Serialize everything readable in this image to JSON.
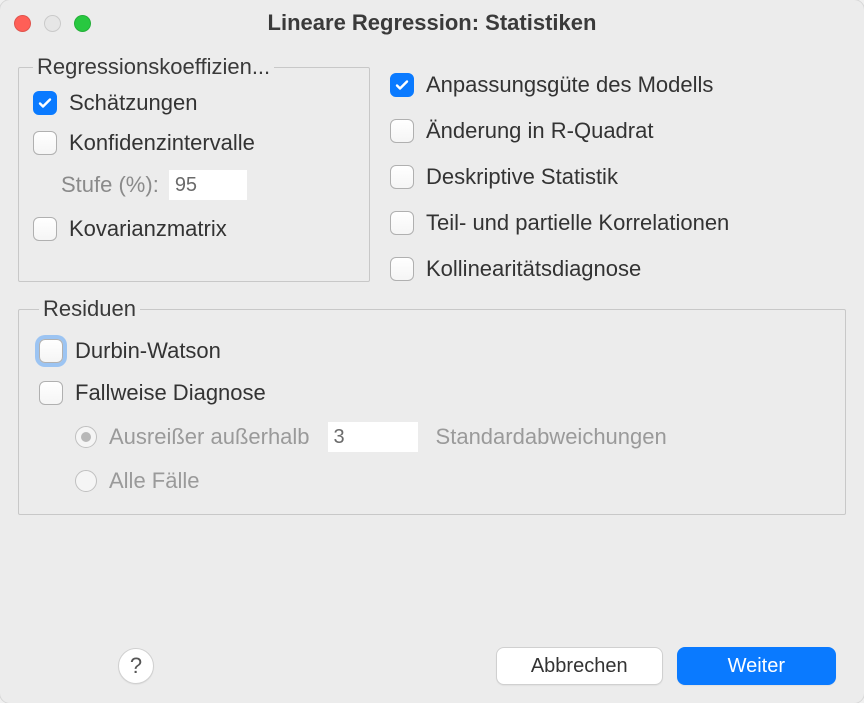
{
  "window": {
    "title": "Lineare Regression: Statistiken"
  },
  "regcoef": {
    "legend": "Regressionskoeffizien...",
    "estimates": {
      "label": "Schätzungen",
      "checked": true
    },
    "confint": {
      "label": "Konfidenzintervalle",
      "checked": false
    },
    "level": {
      "label": "Stufe (%):",
      "value": "95"
    },
    "covmatrix": {
      "label": "Kovarianzmatrix",
      "checked": false
    }
  },
  "right": {
    "modelfit": {
      "label": "Anpassungsgüte des Modells",
      "checked": true
    },
    "rsquared_change": {
      "label": "Änderung in R-Quadrat",
      "checked": false
    },
    "descriptives": {
      "label": "Deskriptive Statistik",
      "checked": false
    },
    "partial": {
      "label": "Teil- und partielle Korrelationen",
      "checked": false
    },
    "collinearity": {
      "label": "Kollinearitätsdiagnose",
      "checked": false
    }
  },
  "residuals": {
    "legend": "Residuen",
    "durbin_watson": {
      "label": "Durbin-Watson",
      "checked": false,
      "focused": true
    },
    "casewise": {
      "label": "Fallweise Diagnose",
      "checked": false
    },
    "outliers": {
      "label": "Ausreißer außerhalb",
      "value": "3",
      "suffix": "Standardabweichungen",
      "selected": true
    },
    "all_cases": {
      "label": "Alle Fälle",
      "selected": false
    }
  },
  "footer": {
    "help": "?",
    "cancel": "Abbrechen",
    "continue": "Weiter"
  }
}
